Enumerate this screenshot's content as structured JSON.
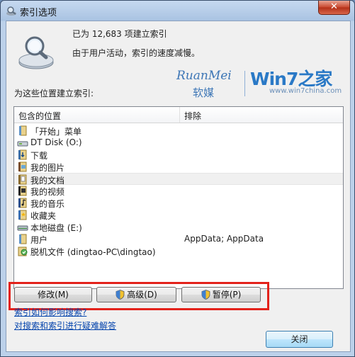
{
  "window": {
    "title": "索引选项",
    "close_glyph": "✕"
  },
  "status": {
    "count_text": "已为 12,683 项建立索引",
    "activity_text": "由于用户活动，索引的速度减慢。"
  },
  "watermark": {
    "ruanmei_en": "RuanMei",
    "ruanmei_cn": "软媒",
    "win7": "Win7之家",
    "url": "www.win7china.com"
  },
  "locations_label": "为这些位置建立索引:",
  "listview": {
    "columns": [
      "包含的位置",
      "排除"
    ],
    "rows": [
      {
        "name": "「开始」菜单",
        "exclude": "",
        "icon": "folder-icon"
      },
      {
        "name": "DT Disk (O:)",
        "exclude": "",
        "icon": "removable-drive-icon"
      },
      {
        "name": "下载",
        "exclude": "",
        "icon": "downloads-folder-icon"
      },
      {
        "name": "我的图片",
        "exclude": "",
        "icon": "pictures-folder-icon"
      },
      {
        "name": "我的文档",
        "exclude": "",
        "icon": "documents-folder-icon",
        "selected": true
      },
      {
        "name": "我的视频",
        "exclude": "",
        "icon": "videos-folder-icon"
      },
      {
        "name": "我的音乐",
        "exclude": "",
        "icon": "music-folder-icon"
      },
      {
        "name": "收藏夹",
        "exclude": "",
        "icon": "favorites-folder-icon"
      },
      {
        "name": "本地磁盘 (E:)",
        "exclude": "",
        "icon": "hard-drive-icon"
      },
      {
        "name": "用户",
        "exclude": "AppData; AppData",
        "icon": "folder-icon"
      },
      {
        "name": "脱机文件 (dingtao-PC\\dingtao)",
        "exclude": "",
        "icon": "offline-files-icon"
      }
    ]
  },
  "buttons": {
    "modify": "修改(M)",
    "advanced": "高级(D)",
    "pause": "暂停(P)",
    "close": "关闭"
  },
  "links": {
    "how_index_affects": "索引如何影响搜索?",
    "troubleshoot": "对搜索和索引进行疑难解答"
  },
  "colors": {
    "highlight": "#e3221b",
    "link": "#0645ad",
    "accent": "#2a79c6"
  }
}
